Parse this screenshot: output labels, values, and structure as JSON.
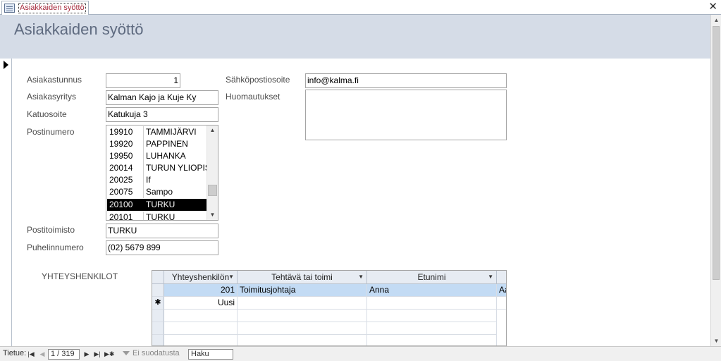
{
  "tab": {
    "title": "Asiakkaiden syöttö",
    "close_symbol": "✕"
  },
  "header": {
    "title": "Asiakkaiden syöttö"
  },
  "form": {
    "customer_id": {
      "label": "Asiakastunnus",
      "value": "1"
    },
    "company": {
      "label": "Asiakasyritys",
      "value": "Kalman Kajo ja Kuje Ky"
    },
    "street": {
      "label": "Katuosoite",
      "value": "Katukuja 3"
    },
    "postal_code": {
      "label": "Postinumero",
      "items": [
        {
          "code": "19910",
          "place": "TAMMIJÄRVI"
        },
        {
          "code": "19920",
          "place": "PAPPINEN"
        },
        {
          "code": "19950",
          "place": "LUHANKA"
        },
        {
          "code": "20014",
          "place": "TURUN YLIOPISTO"
        },
        {
          "code": "20025",
          "place": "If"
        },
        {
          "code": "20075",
          "place": "Sampo"
        },
        {
          "code": "20100",
          "place": "TURKU"
        },
        {
          "code": "20101",
          "place": "TURKU"
        }
      ],
      "selected_code": "20100"
    },
    "post_office": {
      "label": "Postitoimisto",
      "value": "TURKU"
    },
    "phone": {
      "label": "Puhelinnumero",
      "value": "(02) 5679 899"
    },
    "email": {
      "label": "Sähköpostiosoite",
      "value": "info@kalma.fi"
    },
    "notes": {
      "label": "Huomautukset",
      "value": ""
    }
  },
  "contacts": {
    "label": "YHTEYSHENKILOT",
    "columns": [
      "Yhteyshenkilön",
      "Tehtävä tai toimi",
      "Etunimi",
      "Aa"
    ],
    "rows": [
      {
        "id": "201",
        "role": "Toimitusjohtaja",
        "first_name": "Anna",
        "extra": "Aa"
      }
    ],
    "new_row_label": "Uusi",
    "new_row_marker": "✱"
  },
  "navigation": {
    "record_label": "Tietue:",
    "record_position": "1 / 319",
    "filter_label": "Ei suodatusta",
    "search_placeholder": "Haku"
  },
  "colors": {
    "header_band": "#d5dce7",
    "tab_label": "#a5273a",
    "selected_row": "#c3dbf4"
  }
}
